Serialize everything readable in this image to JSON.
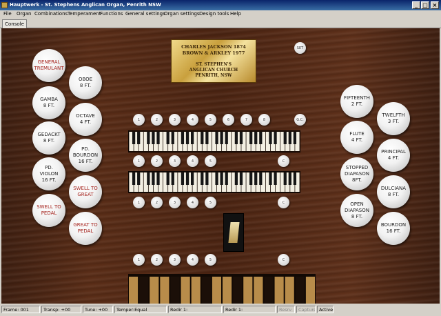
{
  "window": {
    "title": "Hauptwerk - St. Stephens Anglican Organ, Penrith NSW"
  },
  "menu": [
    "File",
    "Organ",
    "Combinations",
    "Temperament",
    "Functions",
    "General settings",
    "Organ settings",
    "Design tools",
    "Help"
  ],
  "tabs": [
    {
      "label": "Console"
    }
  ],
  "plaque": {
    "line1": "CHARLES JACKSON 1874",
    "line2": "BROWN & ARKLEY 1977",
    "line3": "ST. STEPHEN'S",
    "line4": "ANGLICAN CHURCH",
    "line5": "PENRITH, NSW"
  },
  "set_button": "SET",
  "left_stops": [
    {
      "label": "GENERAL\nTREMULANT",
      "color": "red"
    },
    {
      "label": "OBOE\n8 FT.",
      "color": "black"
    },
    {
      "label": "GAMBA\n8 FT.",
      "color": "black"
    },
    {
      "label": "OCTAVE\n4 FT.",
      "color": "black"
    },
    {
      "label": "GEDACKT\n8 FT.",
      "color": "black"
    },
    {
      "label": "PD.\nBOURDON\n16 FT.",
      "color": "black"
    },
    {
      "label": "PD.\nVIOLON\n16 FT.",
      "color": "black"
    },
    {
      "label": "SWELL TO\nGREAT",
      "color": "red"
    },
    {
      "label": "SWELL TO\nPEDAL",
      "color": "red"
    },
    {
      "label": "GREAT TO\nPEDAL",
      "color": "red"
    }
  ],
  "right_stops": [
    {
      "label": "FIFTEENTH\n2 FT.",
      "color": "black"
    },
    {
      "label": "TWELFTH\n3 FT.",
      "color": "black"
    },
    {
      "label": "FLUTE\n4 FT.",
      "color": "black"
    },
    {
      "label": "PRINCIPAL\n4 FT.",
      "color": "black"
    },
    {
      "label": "STOPPED\nDIAPASON\n8FT.",
      "color": "black"
    },
    {
      "label": "DULCIANA\n8 FT.",
      "color": "black"
    },
    {
      "label": "OPEN\nDIAPASON\n8 FT.",
      "color": "black"
    },
    {
      "label": "BOURDON\n16 FT.",
      "color": "black"
    }
  ],
  "pistons": {
    "general": [
      "1",
      "2",
      "3",
      "4",
      "5",
      "6",
      "7",
      "8"
    ],
    "general_cancel": "G.C.",
    "swell": [
      "1",
      "2",
      "3",
      "4",
      "5"
    ],
    "swell_cancel": "C",
    "great": [
      "1",
      "2",
      "3",
      "4",
      "5"
    ],
    "great_cancel": "C",
    "pedal": [
      "1",
      "2",
      "3",
      "4",
      "5"
    ],
    "pedal_cancel": "C"
  },
  "status": {
    "frame": "Frame: 001",
    "transp": "Transp: +00",
    "tune": "Tune: +00",
    "temper": "Temper:Equal",
    "redir1": "Redir 1:",
    "redir2": "Redir 1:",
    "resrv": "Resrv",
    "capture": "Capture",
    "active": "Active"
  },
  "colors": {
    "wood": "#4b2412",
    "plaque_gold": "#d9b75a",
    "stop_red": "#a4221c",
    "titlebar": "#0a246a"
  }
}
